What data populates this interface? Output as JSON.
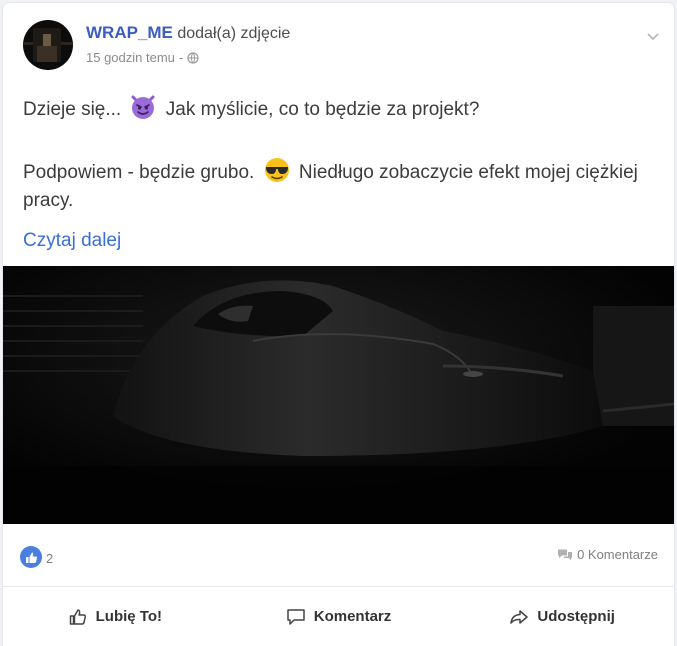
{
  "post": {
    "author": "WRAP_ME",
    "action": "dodał(a) zdjęcie",
    "time": "15 godzin temu",
    "time_separator": "-",
    "privacy_icon": "globe-icon",
    "menu_icon": "chevron-down-icon",
    "text": {
      "line1_before": "Dzieje się...",
      "line1_emoji": "smiling-imp",
      "line1_after": "Jak myślicie, co to będzie za projekt?",
      "line2_before": "Podpowiem - będzie grubo.",
      "line2_emoji": "sunglasses-face",
      "line2_after": "Niedługo zobaczycie efekt mojej ciężkiej pracy."
    },
    "read_more": "Czytaj dalej",
    "photo": "dark car in garage"
  },
  "stats": {
    "likes": "2",
    "comments": "0 Komentarze"
  },
  "actions": {
    "like": "Lubię To!",
    "comment": "Komentarz",
    "share": "Udostępnij"
  },
  "colors": {
    "author": "#3b5dbf",
    "link": "#3b6fd8",
    "like_badge": "#4a7fe0"
  }
}
